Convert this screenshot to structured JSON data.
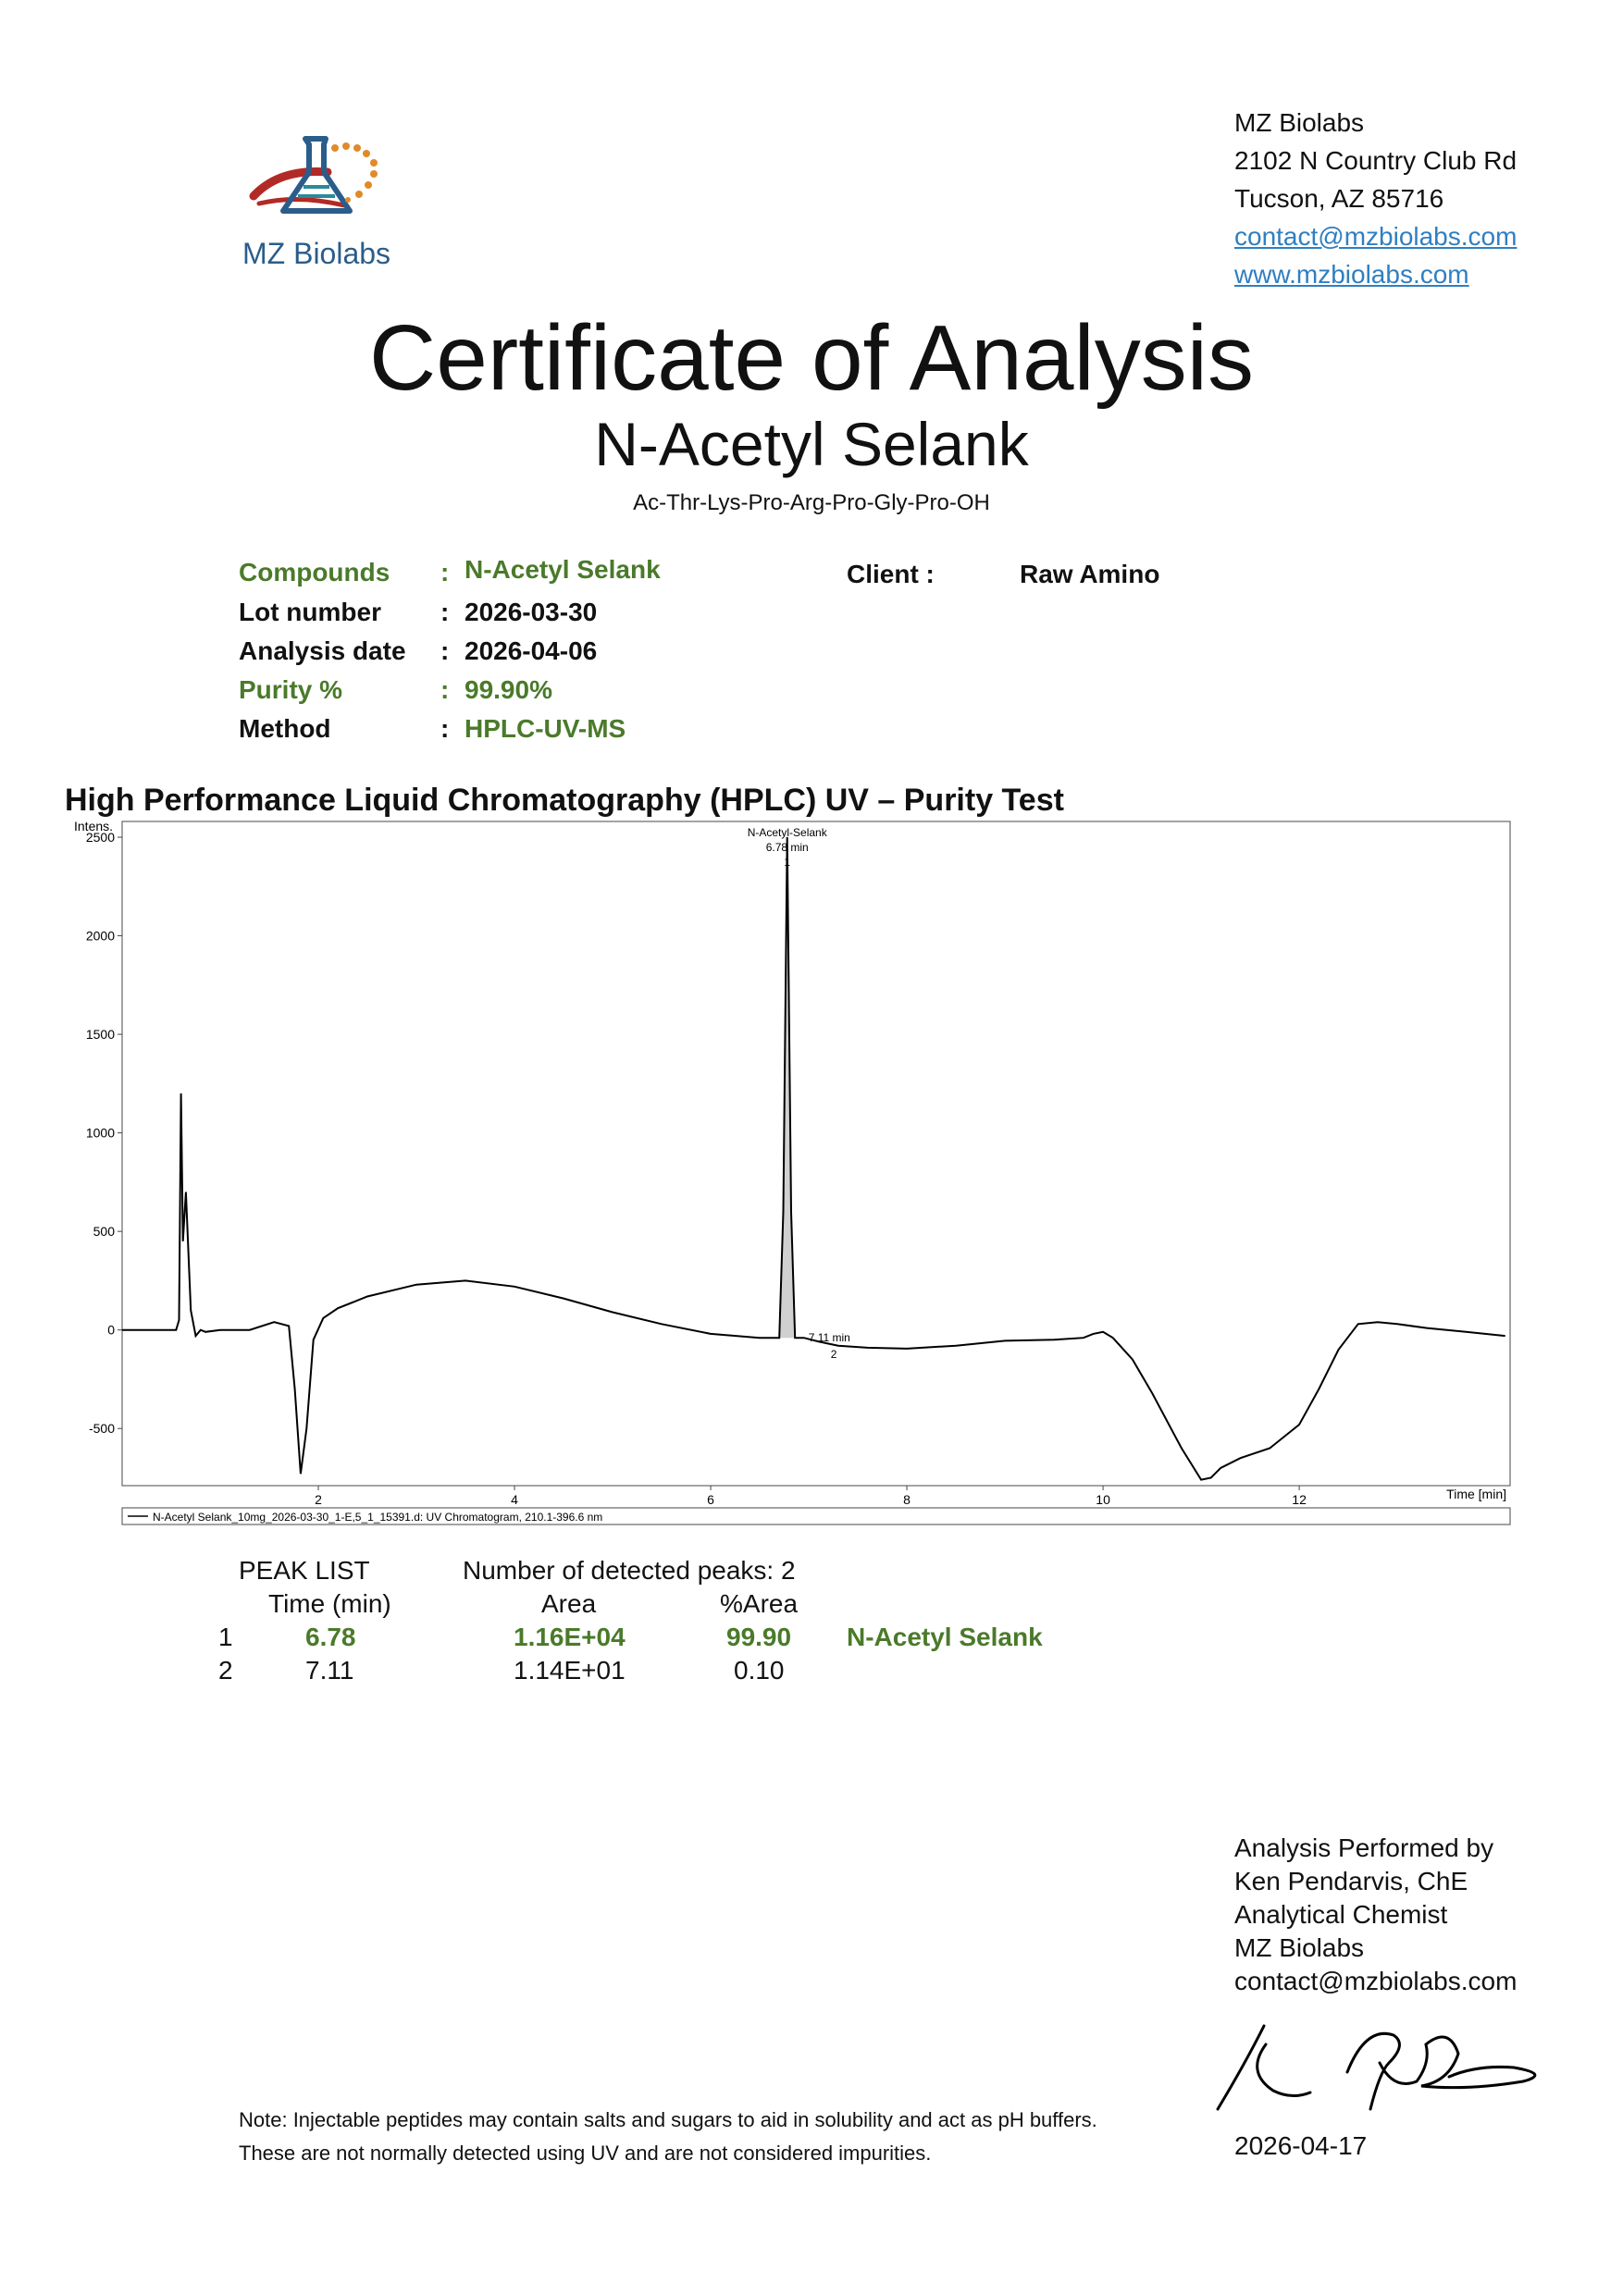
{
  "header": {
    "logo_text": "MZ Biolabs",
    "address_lines": [
      "MZ Biolabs",
      "2102 N Country Club Rd",
      "Tucson, AZ 85716"
    ],
    "email": "contact@mzbiolabs.com",
    "website": "www.mzbiolabs.com"
  },
  "title": "Certificate of Analysis",
  "subtitle": "N-Acetyl Selank",
  "sequence": "Ac-Thr-Lys-Pro-Arg-Pro-Gly-Pro-OH",
  "info": {
    "colon": ":",
    "compounds_label": "Compounds",
    "compounds_value": "N-Acetyl Selank",
    "lot_label": "Lot number",
    "lot_value": "2026-03-30",
    "analysis_date_label": "Analysis date",
    "analysis_date_value": "2026-04-06",
    "purity_label": "Purity %",
    "purity_value": "99.90%",
    "method_label": "Method",
    "method_value": "HPLC-UV-MS",
    "client_label": "Client :",
    "client_value": "Raw Amino"
  },
  "section_title": "High Performance Liquid Chromatography (HPLC) UV – Purity Test",
  "chart_data": {
    "type": "line",
    "ylabel": "Intens.",
    "xlabel": "Time [min]",
    "xlim": [
      0.0,
      14.15
    ],
    "ylim": [
      -790,
      2580
    ],
    "xticks": [
      2,
      4,
      6,
      8,
      10,
      12
    ],
    "yticks": [
      2500,
      2000,
      1500,
      1000,
      500,
      0,
      -500
    ],
    "legend": "N-Acetyl Selank_10mg_2026-03-30_1-E,5_1_15391.d: UV Chromatogram, 210.1-396.6 nm",
    "peak_annotations": [
      {
        "name": "N-Acetyl-Selank",
        "time_label": "6.78 min",
        "number": "1",
        "x": 6.78,
        "y": 2500
      },
      {
        "name": "",
        "time_label": "7.11 min",
        "number": "2",
        "x": 7.11,
        "y": -20
      }
    ],
    "series": [
      {
        "x": [
          0.0,
          0.55,
          0.58,
          0.6,
          0.62,
          0.65,
          0.7,
          0.75,
          0.8,
          0.85,
          1.0,
          1.3,
          1.55,
          1.7,
          1.76,
          1.82,
          1.88,
          1.95,
          2.05,
          2.2,
          2.5,
          3.0,
          3.5,
          4.0,
          4.5,
          5.0,
          5.5,
          6.0,
          6.5,
          6.7,
          6.74,
          6.78,
          6.82,
          6.86,
          6.95,
          7.11,
          7.3,
          7.6,
          8.0,
          8.5,
          9.0,
          9.5,
          9.8,
          9.9,
          10.0,
          10.1,
          10.3,
          10.5,
          10.8,
          11.0,
          11.1,
          11.2,
          11.4,
          11.7,
          12.0,
          12.2,
          12.4,
          12.6,
          12.8,
          13.0,
          13.3,
          13.7,
          14.1
        ],
        "y": [
          0,
          0,
          50,
          1200,
          450,
          700,
          100,
          -30,
          0,
          -10,
          0,
          0,
          40,
          20,
          -300,
          -730,
          -500,
          -50,
          60,
          110,
          170,
          230,
          250,
          220,
          160,
          90,
          30,
          -20,
          -40,
          -40,
          600,
          2500,
          600,
          -40,
          -40,
          -60,
          -80,
          -90,
          -95,
          -80,
          -55,
          -50,
          -40,
          -20,
          -10,
          -40,
          -150,
          -320,
          -600,
          -760,
          -750,
          -700,
          -650,
          -600,
          -480,
          -300,
          -100,
          30,
          40,
          30,
          10,
          -10,
          -30
        ]
      }
    ]
  },
  "peak_list": {
    "title": "PEAK LIST",
    "detected": "Number of detected peaks: 2",
    "columns": [
      "Time (min)",
      "Area",
      "%Area"
    ],
    "rows": [
      {
        "num": "1",
        "time": "6.78",
        "area": "1.16E+04",
        "pct": "99.90",
        "name": "N-Acetyl Selank"
      },
      {
        "num": "2",
        "time": "7.11",
        "area": "1.14E+01",
        "pct": "0.10",
        "name": ""
      }
    ]
  },
  "performer": {
    "lines": [
      "Analysis Performed by",
      "Ken Pendarvis, ChE",
      "Analytical Chemist",
      "MZ Biolabs",
      "contact@mzbiolabs.com"
    ],
    "date": "2026-04-17"
  },
  "note": {
    "line1": "Note: Injectable peptides may contain salts and sugars to aid in solubility and act as pH buffers.",
    "line2": "These are not normally detected using UV and are not considered impurities."
  }
}
